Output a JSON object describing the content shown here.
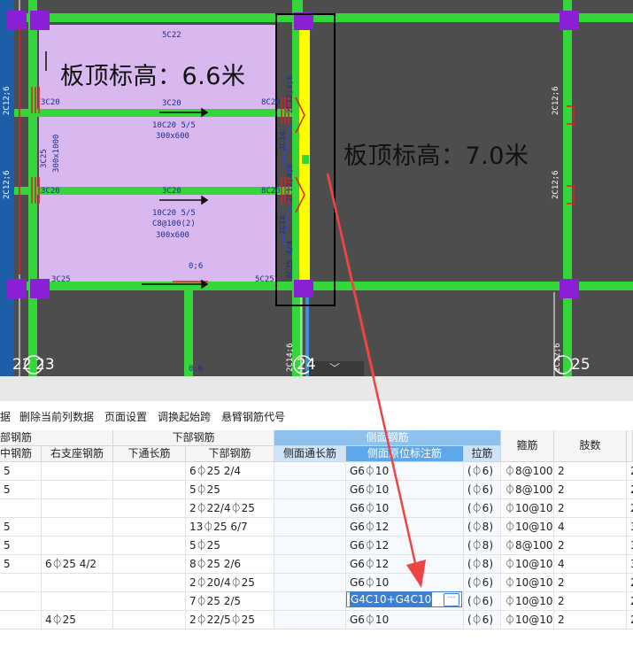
{
  "cad": {
    "left_plate_label": "板顶标高：6.6米",
    "right_plate_label": "板顶标高：7.0米",
    "beam_labels": [
      "5C22",
      "3C20",
      "3C20",
      "10C20 5/5",
      "300x600",
      "3C20",
      "10C20 5/5",
      "C8@100(2)",
      "300x600",
      "8C20",
      "8C20",
      "3C25",
      "3C25",
      "300x1000",
      "2C12;6",
      "2C12;6",
      "2C12;6",
      "2C14",
      "2C14",
      "2C12;4;6",
      "2C12;4;6",
      "8C25 4/4",
      "5C25",
      "0;6",
      "0;6",
      "2C12;6",
      "2C12;6",
      "3C25",
      "5C22"
    ],
    "axis_labels": [
      "22",
      "23",
      "24",
      "25"
    ],
    "collapse_arrow": "﹀"
  },
  "toolbar": {
    "items": [
      "据",
      "删除当前列数据",
      "页面设置",
      "调换起始跨",
      "悬臂钢筋代号"
    ]
  },
  "table": {
    "group_headers": {
      "top": "部钢筋",
      "bottom": "下部钢筋",
      "side": "侧面钢筋"
    },
    "columns": {
      "c0": "中钢筋",
      "c1": "右支座钢筋",
      "c2": "下通长筋",
      "c3": "下部钢筋",
      "c4": "侧面通长筋",
      "c5": "侧面原位标注筋",
      "c6": "拉筋",
      "c7": "箍筋",
      "c8": "肢数"
    },
    "rows": [
      {
        "c0": "5",
        "c1": "",
        "c2": "",
        "c3": "6⏀25 2/4",
        "c4": "",
        "c5": "G6⏀10",
        "c6": "(⏀6)",
        "c7": "⏀8@100(",
        "c8": "2",
        "c9": "2"
      },
      {
        "c0": "5",
        "c1": "",
        "c2": "",
        "c3": "5⏀25",
        "c4": "",
        "c5": "G6⏀10",
        "c6": "(⏀6)",
        "c7": "⏀8@100(",
        "c8": "2",
        "c9": "2"
      },
      {
        "c0": "",
        "c1": "",
        "c2": "",
        "c3": "2⏀22/4⏀25",
        "c4": "",
        "c5": "G6⏀10",
        "c6": "(⏀6)",
        "c7": "⏀10@10",
        "c8": "2",
        "c9": "2"
      },
      {
        "c0": "5",
        "c1": "",
        "c2": "",
        "c3": "13⏀25 6/7",
        "c4": "",
        "c5": "G6⏀12",
        "c6": "(⏀8)",
        "c7": "⏀10@10",
        "c8": "4",
        "c9": "3"
      },
      {
        "c0": "5",
        "c1": "",
        "c2": "",
        "c3": "5⏀25",
        "c4": "",
        "c5": "G6⏀12",
        "c6": "(⏀8)",
        "c7": "⏀8@100(",
        "c8": "2",
        "c9": "3"
      },
      {
        "c0": "5",
        "c1": "6⏀25 4/2",
        "c2": "",
        "c3": "8⏀25 2/6",
        "c4": "",
        "c5": "G6⏀12",
        "c6": "(⏀8)",
        "c7": "⏀10@10",
        "c8": "4",
        "c9": "3"
      },
      {
        "c0": "",
        "c1": "",
        "c2": "",
        "c3": "2⏀20/4⏀25",
        "c4": "",
        "c5": "G6⏀10",
        "c6": "(⏀6)",
        "c7": "⏀10@10",
        "c8": "2",
        "c9": "2"
      },
      {
        "c0": "",
        "c1": "",
        "c2": "",
        "c3": "7⏀25 2/5",
        "c4": "",
        "c5": "",
        "c6": "(⏀6)",
        "c7": "⏀10@10",
        "c8": "2",
        "c9": "2"
      },
      {
        "c0": "",
        "c1": "4⏀25",
        "c2": "",
        "c3": "2⏀22/5⏀25",
        "c4": "",
        "c5": "G6⏀10",
        "c6": "(⏀6)",
        "c7": "⏀10@10",
        "c8": "2",
        "c9": "2"
      }
    ],
    "editing_cell": {
      "value": "G4C10+G4C10",
      "button": "···"
    }
  },
  "colors": {
    "canvas_bg": "#4d4d4d",
    "plate_fill": "#d9b8f0",
    "beam_green": "#35d63a",
    "column_purple": "#8a1fd6",
    "highlight_yellow": "#ffff00",
    "annotation_arrow": "#ef4444",
    "header_blue": "#8ec1ec",
    "selected_header": "#5ea7e8"
  }
}
